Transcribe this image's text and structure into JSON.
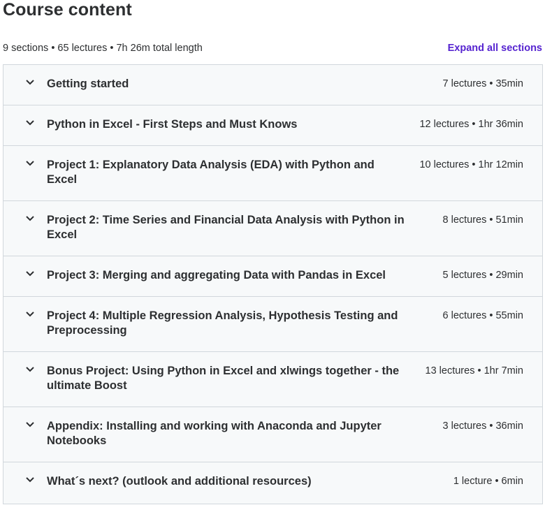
{
  "header": {
    "title": "Course content",
    "summary": "9 sections • 65 lectures • 7h 26m total length",
    "expand_label": "Expand all sections"
  },
  "sections": [
    {
      "title": "Getting started",
      "meta": "7 lectures • 35min"
    },
    {
      "title": "Python in Excel - First Steps and Must Knows",
      "meta": "12 lectures • 1hr 36min"
    },
    {
      "title": "Project 1: Explanatory Data Analysis (EDA) with Python and Excel",
      "meta": "10 lectures • 1hr 12min"
    },
    {
      "title": "Project 2: Time Series and Financial Data Analysis with Python in Excel",
      "meta": "8 lectures • 51min"
    },
    {
      "title": "Project 3: Merging and aggregating Data with Pandas in Excel",
      "meta": "5 lectures • 29min"
    },
    {
      "title": "Project 4: Multiple Regression Analysis, Hypothesis Testing and Preprocessing",
      "meta": "6 lectures • 55min"
    },
    {
      "title": "Bonus Project: Using Python in Excel and xlwings together - the ultimate Boost",
      "meta": "13 lectures • 1hr 7min"
    },
    {
      "title": "Appendix: Installing and working with Anaconda and Jupyter Notebooks",
      "meta": "3 lectures • 36min"
    },
    {
      "title": "What´s next? (outlook and additional resources)",
      "meta": "1 lecture • 6min"
    }
  ],
  "icons": {
    "toggle": "chevron-down-icon"
  },
  "colors": {
    "accent": "#5624d0",
    "section_bg": "#f7f9fa",
    "border": "#d1d7dc",
    "text": "#2d2f31"
  }
}
